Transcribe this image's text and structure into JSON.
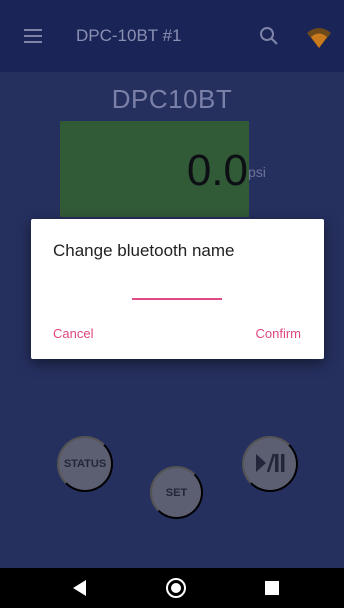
{
  "appbar": {
    "title": "DPC-10BT #1"
  },
  "device": {
    "name": "DPC10BT",
    "reading": "0.0",
    "unit": "psi"
  },
  "controls": {
    "status_label": "STATUS",
    "set_label": "SET"
  },
  "dialog": {
    "title": "Change bluetooth name",
    "input_value": "",
    "cancel_label": "Cancel",
    "confirm_label": "Confirm"
  },
  "colors": {
    "appbar": "#1b2456",
    "background": "#26305f",
    "gauge": "#315a37",
    "accent": "#e0457f",
    "wifi": "#c97a1c"
  },
  "icons": {
    "menu": "menu-icon",
    "search": "search-icon",
    "wifi": "wifi-icon",
    "play_pause": "play-pause-icon",
    "nav_back": "back-icon",
    "nav_home": "home-icon",
    "nav_recents": "recents-icon"
  }
}
